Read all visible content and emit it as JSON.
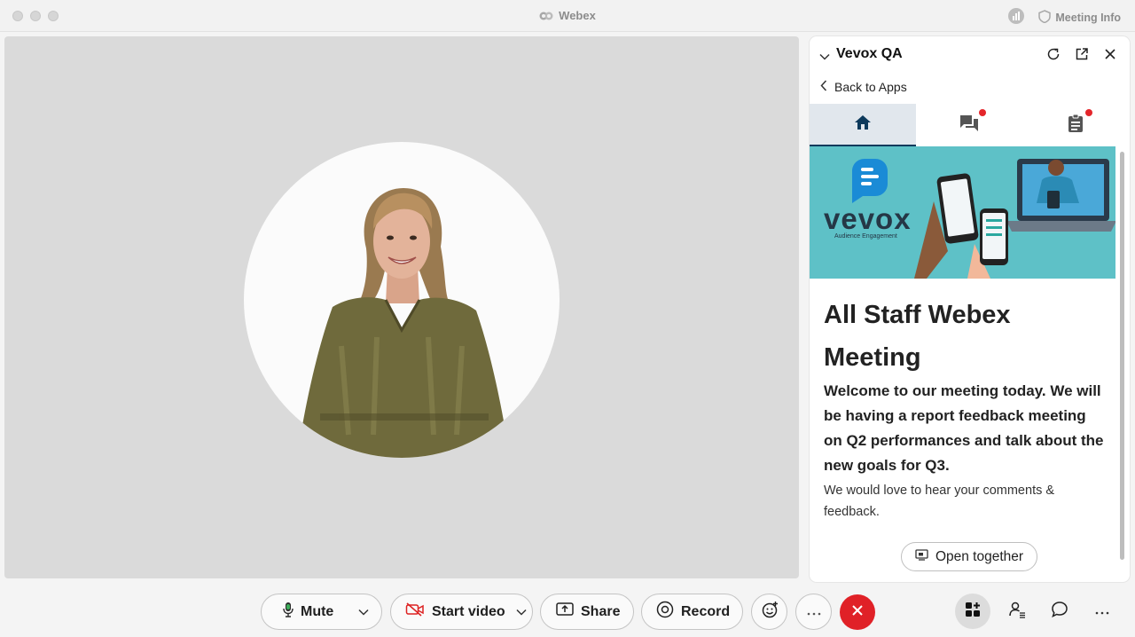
{
  "titlebar": {
    "app_name": "Webex",
    "meeting_info": "Meeting Info"
  },
  "panel": {
    "title": "Vevox QA",
    "back_label": "Back to Apps",
    "tabs": [
      {
        "icon": "home-icon",
        "active": true,
        "notification": false
      },
      {
        "icon": "chat-icon",
        "active": false,
        "notification": true
      },
      {
        "icon": "clipboard-icon",
        "active": false,
        "notification": true
      }
    ],
    "banner": {
      "brand": "vevox",
      "tagline": "Audience Engagement"
    },
    "heading": "All Staff Webex Meeting",
    "lead": "Welcome to our meeting today. We will be having a report feedback meeting on Q2 performances and talk about the new goals for Q3.",
    "body": "We would love to hear your comments & feedback.",
    "open_together": "Open together"
  },
  "toolbar": {
    "mute": "Mute",
    "start_video": "Start video",
    "share": "Share",
    "record": "Record"
  },
  "colors": {
    "end_call": "#e02127",
    "accent_navy": "#0d3a5c",
    "banner_teal": "#5ec1c7",
    "notification": "#e4262b"
  }
}
